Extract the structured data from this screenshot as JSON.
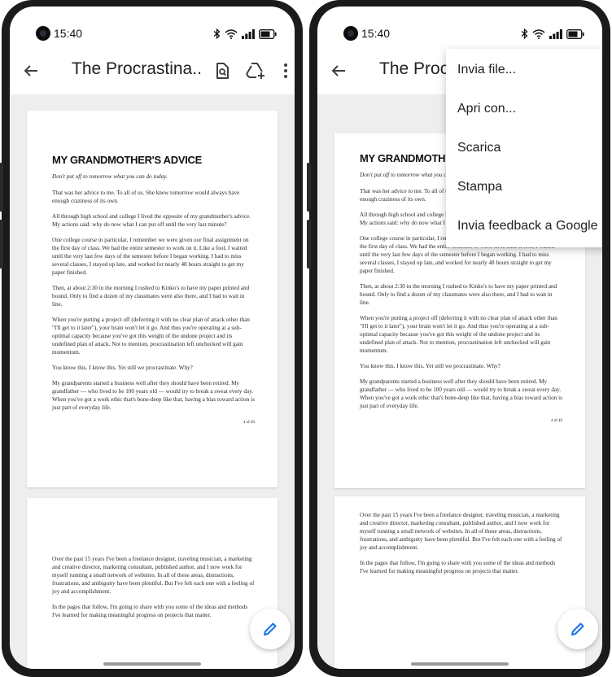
{
  "status": {
    "time": "15:40"
  },
  "toolbar": {
    "title_left": "The Procrastina...",
    "title_right": "The Procras"
  },
  "menu": {
    "items": [
      "Invia file...",
      "Apri con...",
      "Scarica",
      "Stampa",
      "Invia feedback a Google"
    ]
  },
  "page1": {
    "heading": "MY GRANDMOTHER'S ADVICE",
    "subtitle": "Don't put off to tomorrow what you can do today.",
    "p1": "That was her advice to me. To all of us. She knew tomorrow would always have enough craziness of its own.",
    "p2": "All through high school and college I lived the opposite of my grandmother's advice. My actions said: why do now what I can put off until the very last minute?",
    "p3": "One college course in particular, I remember we were given our final assignment on the first day of class. We had the entire semester to work on it. Like a fool, I waited until the very last few days of the semester before I began working. I had to miss several classes, I stayed up late, and worked for nearly 48 hours straight to get my paper finished.",
    "p4": "Then, at about 2:30 in the morning I rushed to Kinko's to have my paper printed and bound. Only to find a dozen of my classmates were also there, and I had to wait in line.",
    "p5": "When you're putting a project off (deferring it with no clear plan of attack other than \"I'll get to it later\"), your brain won't let it go. And thus you're operating at a sub-optimal capacity because you've got this weight of the undone project and its undefined plan of attack. Not to mention, procrastination left unchecked will gain momentum.",
    "p6": "You know this. I know this. Yet still we procrastinate. Why?",
    "p7": "My grandparents started a business well after they should have been retired. My grandfather — who lived to be 100 years old — would try to break a sweat every day. When you've got a work ethic that's bone-deep like that, having a bias toward action is just part of everyday life.",
    "pageno": "4 of 40"
  },
  "page2": {
    "p1": "Over the past 15 years I've been a freelance designer, traveling musician, a marketing and creative director, marketing consultant, published author, and I now work for myself running a small network of websites. In all of these areas, distractions, frustrations, and ambiguity have been plentiful. But I've felt each one with a feeling of joy and accomplishment.",
    "p2": "In the pages that follow, I'm going to share with you some of the ideas and methods I've learned for making meaningful progress on projects that matter."
  },
  "colors": {
    "accent": "#1a73e8",
    "text": "#202124",
    "background": "#eeeeee"
  },
  "icons": {
    "back": "arrow-left-icon",
    "find": "find-in-page-icon",
    "drive": "add-to-drive-icon",
    "more": "more-vert-icon",
    "edit": "pencil-icon"
  }
}
